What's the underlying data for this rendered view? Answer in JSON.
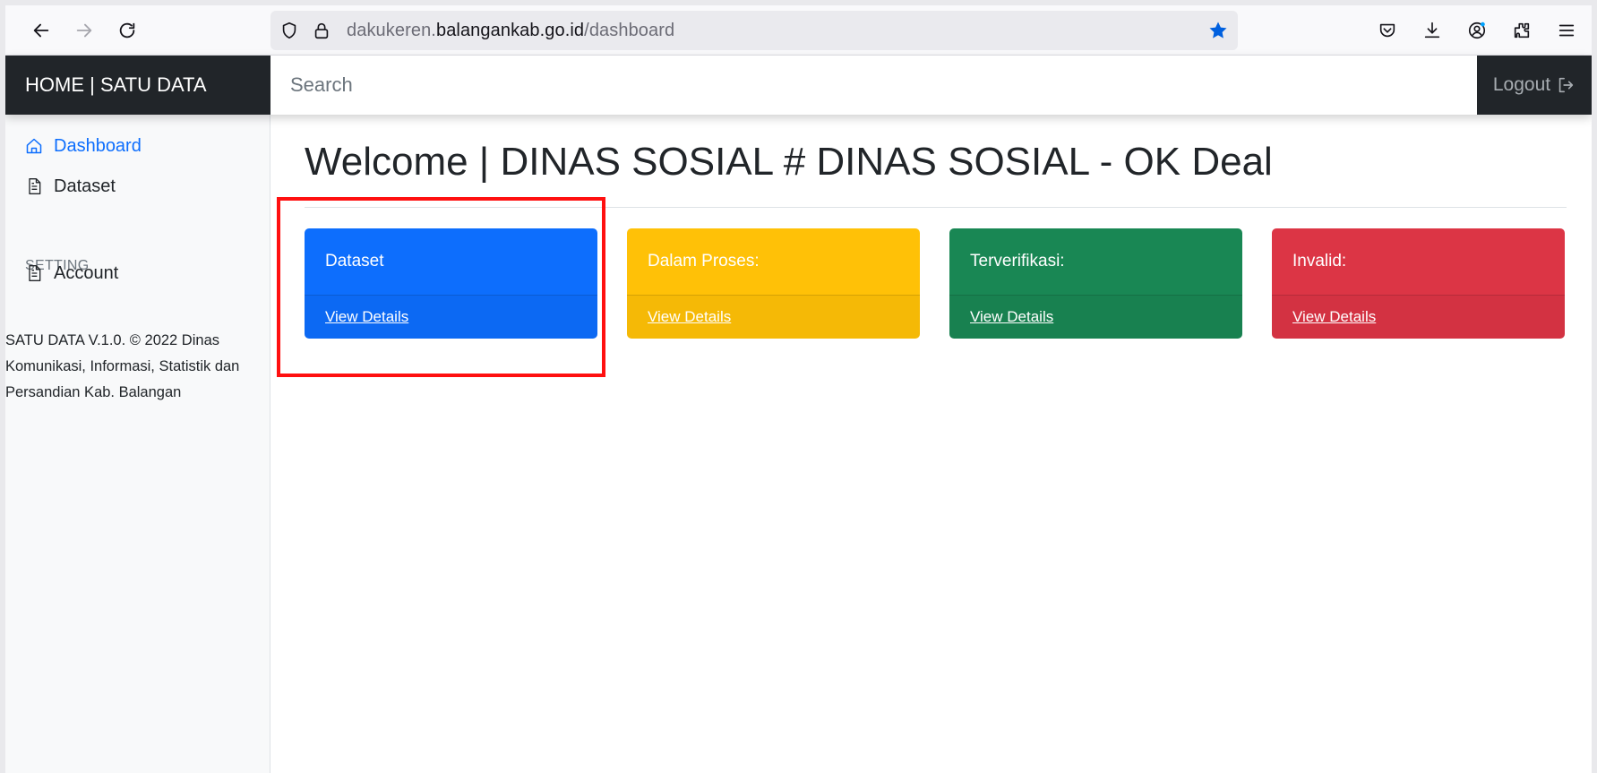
{
  "browser": {
    "url_prefix": "dakukeren.",
    "url_host": "balangankab.go.id",
    "url_path": "/dashboard"
  },
  "header": {
    "brand": "HOME | SATU DATA",
    "search_placeholder": "Search",
    "logout_label": "Logout"
  },
  "sidebar": {
    "items": [
      {
        "label": "Dashboard",
        "icon": "house-icon"
      },
      {
        "label": "Dataset",
        "icon": "file-text-icon"
      }
    ],
    "setting_heading": "SETTING",
    "setting_items": [
      {
        "label": "Account",
        "icon": "file-text-icon"
      }
    ],
    "footer": "SATU DATA V.1.0. © 2022 Dinas Komunikasi, Informasi, Statistik dan Persandian Kab. Balangan"
  },
  "main": {
    "title": "Welcome | DINAS SOSIAL # DINAS SOSIAL - OK Deal",
    "cards": [
      {
        "label": "Dataset",
        "link": "View Details",
        "color": "#0d6efd",
        "text_color": "#ffffff"
      },
      {
        "label": "Dalam Proses:",
        "link": "View Details",
        "color": "#ffc107",
        "text_color": "#ffffff"
      },
      {
        "label": "Terverifikasi:",
        "link": "View Details",
        "color": "#198754",
        "text_color": "#ffffff"
      },
      {
        "label": "Invalid:",
        "link": "View Details",
        "color": "#dc3545",
        "text_color": "#ffffff"
      }
    ]
  },
  "colors": {
    "accent": "#0d6efd",
    "dark": "#212529",
    "highlight": "#ff1010"
  }
}
